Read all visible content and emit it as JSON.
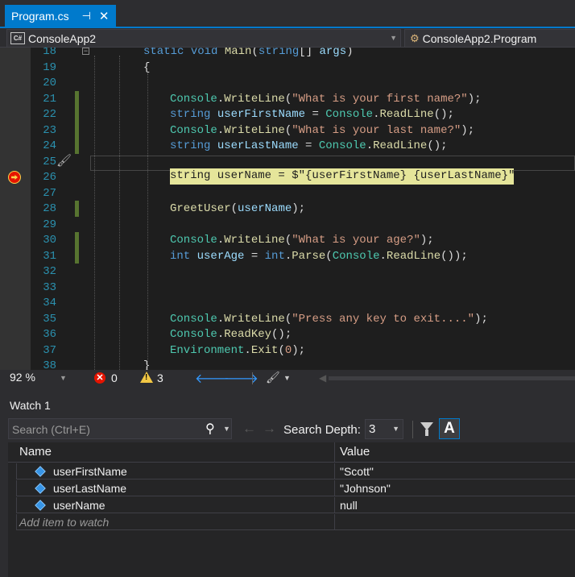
{
  "tab": {
    "title": "Program.cs",
    "pin_glyph": "⊣",
    "close_glyph": "✕"
  },
  "navbar": {
    "project": "ConsoleApp2",
    "project_badge": "C#",
    "class": "ConsoleApp2.Program"
  },
  "code_lines": [
    {
      "n": "18",
      "html": "<span class=\"kw\">static</span> <span class=\"kw\">void</span> <span class=\"fn\">Main</span>(<span class=\"kw\">string</span>[] <span class=\"id\">args</span>)",
      "indent": 0
    },
    {
      "n": "19",
      "html": "{",
      "indent": 0
    },
    {
      "n": "20",
      "html": "",
      "indent": 0
    },
    {
      "n": "21",
      "html": "<span class=\"ty\">Console</span>.<span class=\"fn\">WriteLine</span>(<span class=\"st\">\"What is your first name?\"</span>);",
      "indent": 1
    },
    {
      "n": "22",
      "html": "<span class=\"kw\">string</span> <span class=\"id\">userFirstName</span> = <span class=\"ty\">Console</span>.<span class=\"fn\">ReadLine</span>();",
      "indent": 1
    },
    {
      "n": "23",
      "html": "<span class=\"ty\">Console</span>.<span class=\"fn\">WriteLine</span>(<span class=\"st\">\"What is your last name?\"</span>);",
      "indent": 1
    },
    {
      "n": "24",
      "html": "<span class=\"kw\">string</span> <span class=\"id\">userLastName</span> = <span class=\"ty\">Console</span>.<span class=\"fn\">ReadLine</span>();",
      "indent": 1
    },
    {
      "n": "25",
      "html": "",
      "indent": 1
    },
    {
      "n": "26",
      "html": "",
      "indent": 1
    },
    {
      "n": "27",
      "html": "",
      "indent": 1
    },
    {
      "n": "28",
      "html": "<span class=\"fn\">GreetUser</span>(<span class=\"id\">userName</span>);",
      "indent": 1
    },
    {
      "n": "29",
      "html": "",
      "indent": 1
    },
    {
      "n": "30",
      "html": "<span class=\"ty\">Console</span>.<span class=\"fn\">WriteLine</span>(<span class=\"st\">\"What is your age?\"</span>);",
      "indent": 1
    },
    {
      "n": "31",
      "html": "<span class=\"kw\">int</span> <span class=\"id\">userAge</span> = <span class=\"kw\">int</span>.<span class=\"fn\">Parse</span>(<span class=\"ty\">Console</span>.<span class=\"fn\">ReadLine</span>());",
      "indent": 1
    },
    {
      "n": "32",
      "html": "",
      "indent": 1
    },
    {
      "n": "33",
      "html": "",
      "indent": 1
    },
    {
      "n": "34",
      "html": "",
      "indent": 1
    },
    {
      "n": "35",
      "html": "<span class=\"ty\">Console</span>.<span class=\"fn\">WriteLine</span>(<span class=\"st\">\"Press any key to exit....\"</span>);",
      "indent": 1
    },
    {
      "n": "36",
      "html": "<span class=\"ty\">Console</span>.<span class=\"fn\">ReadKey</span>();",
      "indent": 1
    },
    {
      "n": "37",
      "html": "<span class=\"ty\">Environment</span>.<span class=\"fn\">Exit</span>(<span class=\"st\">0</span>);",
      "indent": 1
    },
    {
      "n": "38",
      "html": "}",
      "indent": 0
    }
  ],
  "current_line_code": "string userName = $\"{userFirstName} {userLastName}\";",
  "editor_status": {
    "zoom": "92 %",
    "errors": "0",
    "warnings": "3"
  },
  "watch": {
    "title": "Watch 1",
    "search_placeholder": "Search (Ctrl+E)",
    "depth_label": "Search Depth:",
    "depth_value": "3",
    "col_name": "Name",
    "col_value": "Value",
    "rows": [
      {
        "name": "userFirstName",
        "value": "\"Scott\""
      },
      {
        "name": "userLastName",
        "value": "\"Johnson\""
      },
      {
        "name": "userName",
        "value": "null"
      }
    ],
    "add_item": "Add item to watch"
  },
  "colors": {
    "accent": "#007acc",
    "editor_bg": "#1e1e1e",
    "current_line": "#e5e59a"
  }
}
